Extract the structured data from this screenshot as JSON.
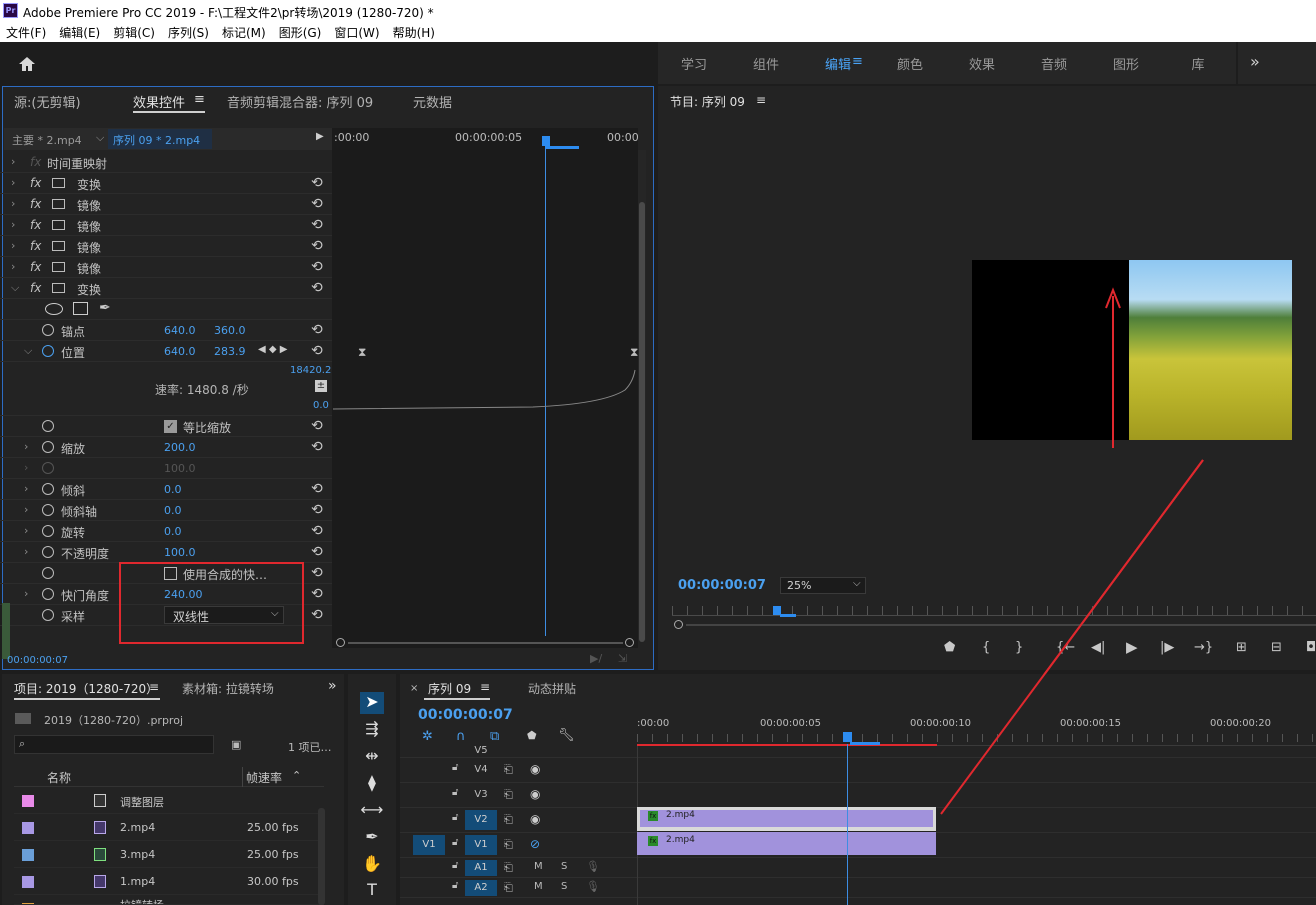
{
  "app": {
    "title": "Adobe Premiere Pro CC 2019 - F:\\工程文件2\\pr转场\\2019 (1280-720)  *"
  },
  "menu": [
    "文件(F)",
    "编辑(E)",
    "剪辑(C)",
    "序列(S)",
    "标记(M)",
    "图形(G)",
    "窗口(W)",
    "帮助(H)"
  ],
  "workspaces": [
    "学习",
    "组件",
    "编辑",
    "颜色",
    "效果",
    "音频",
    "图形",
    "库"
  ],
  "workspace_active": "编辑",
  "workspace_menu": "≡",
  "more_icon": "»",
  "effect_panel": {
    "tabs": [
      "源:(无剪辑)",
      "效果控件",
      "音频剪辑混合器: 序列 09",
      "元数据"
    ],
    "menu_glyph": "≡",
    "master_clip": "主要 * 2.mp4",
    "sequence_clip": "序列 09 * 2.mp4",
    "ruler": [
      ":00:00",
      "00:00:00:05",
      "00:00"
    ],
    "rows": [
      {
        "label": "时间重映射"
      },
      {
        "label": "变换"
      },
      {
        "label": "镜像"
      },
      {
        "label": "镜像"
      },
      {
        "label": "镜像"
      },
      {
        "label": "镜像"
      },
      {
        "label": "变换"
      }
    ],
    "anchor": {
      "label": "锚点",
      "x": "640.0",
      "y": "360.0"
    },
    "position": {
      "label": "位置",
      "x": "640.0",
      "y": "283.9"
    },
    "graph_max": "18420.2",
    "graph_min": "0.0",
    "rate": "速率: 1480.8 /秒",
    "uniform_scale": "等比缩放",
    "scale": {
      "label": "缩放",
      "value": "200.0"
    },
    "scale_width": "100.0",
    "skew": {
      "label": "倾斜",
      "value": "0.0"
    },
    "skew_axis": {
      "label": "倾斜轴",
      "value": "0.0"
    },
    "rotation": {
      "label": "旋转",
      "value": "0.0"
    },
    "opacity": {
      "label": "不透明度",
      "value": "100.0"
    },
    "composite": "使用合成的快…",
    "shutter": {
      "label": "快门角度",
      "value": "240.00"
    },
    "sampling": {
      "label": "采样",
      "value": "双线性"
    },
    "timecode": "00:00:00:07"
  },
  "program": {
    "title": "节目: 序列 09",
    "menu_glyph": "≡",
    "timecode": "00:00:00:07",
    "zoom": "25%"
  },
  "project": {
    "tab1": "项目: 2019（1280-720）",
    "tab2": "素材箱: 拉镜转场",
    "menu_glyph": "≡",
    "file": "2019（1280-720）.prproj",
    "count": "1 项已…",
    "col_name": "名称",
    "col_fps": "帧速率",
    "items": [
      {
        "name": "调整图层",
        "fps": "",
        "color": "#e88ae8"
      },
      {
        "name": "2.mp4",
        "fps": "25.00 fps",
        "color": "#a898e4"
      },
      {
        "name": "3.mp4",
        "fps": "25.00 fps",
        "color": "#6a9fd8"
      },
      {
        "name": "1.mp4",
        "fps": "30.00 fps",
        "color": "#a898e4"
      },
      {
        "name": "拉镜转场",
        "fps": "",
        "color": "#e0a040"
      }
    ]
  },
  "timeline": {
    "tab1": "序列 09",
    "tab2": "动态拼贴",
    "menu_glyph": "≡",
    "timecode": "00:00:00:07",
    "ruler": [
      ":00:00",
      "00:00:00:05",
      "00:00:00:10",
      "00:00:00:15",
      "00:00:00:20"
    ],
    "tracks": [
      {
        "name": "V5"
      },
      {
        "name": "V4"
      },
      {
        "name": "V3"
      },
      {
        "name": "V2"
      },
      {
        "name": "V1"
      },
      {
        "name": "A1"
      },
      {
        "name": "A2"
      }
    ],
    "source_patch": "V1",
    "mute": "M",
    "solo": "S",
    "clip_v2": "2.mp4",
    "clip_v1": "2.mp4",
    "fx_badge": "fx",
    "close_glyph": "×"
  },
  "colors": {
    "accent": "#4aa3f5",
    "clip": "#a192dc",
    "annotation": "#e0282e"
  }
}
